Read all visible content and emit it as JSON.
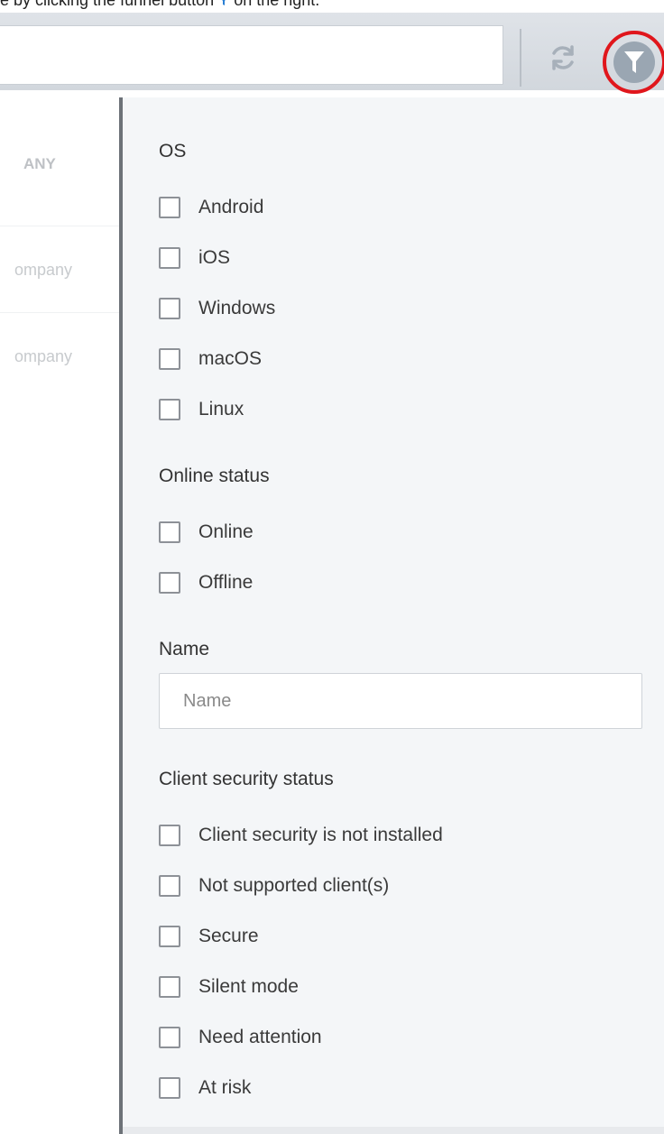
{
  "caption": {
    "text_before": "e by clicking the funnel button",
    "text_after": "on the right."
  },
  "toolbar": {
    "search_value": "",
    "refresh_icon": "refresh-icon",
    "filter_icon": "funnel-icon",
    "highlight_color": "#e0161c"
  },
  "background_table": {
    "header": "ANY",
    "rows": [
      "ompany",
      "ompany"
    ]
  },
  "filter_panel": {
    "os": {
      "title": "OS",
      "options": [
        "Android",
        "iOS",
        "Windows",
        "macOS",
        "Linux"
      ]
    },
    "online_status": {
      "title": "Online status",
      "options": [
        "Online",
        "Offline"
      ]
    },
    "name": {
      "title": "Name",
      "placeholder": "Name",
      "value": ""
    },
    "client_security_status": {
      "title": "Client security status",
      "options": [
        "Client security is not installed",
        "Not supported client(s)",
        "Secure",
        "Silent mode",
        "Need attention",
        "At risk"
      ]
    }
  }
}
